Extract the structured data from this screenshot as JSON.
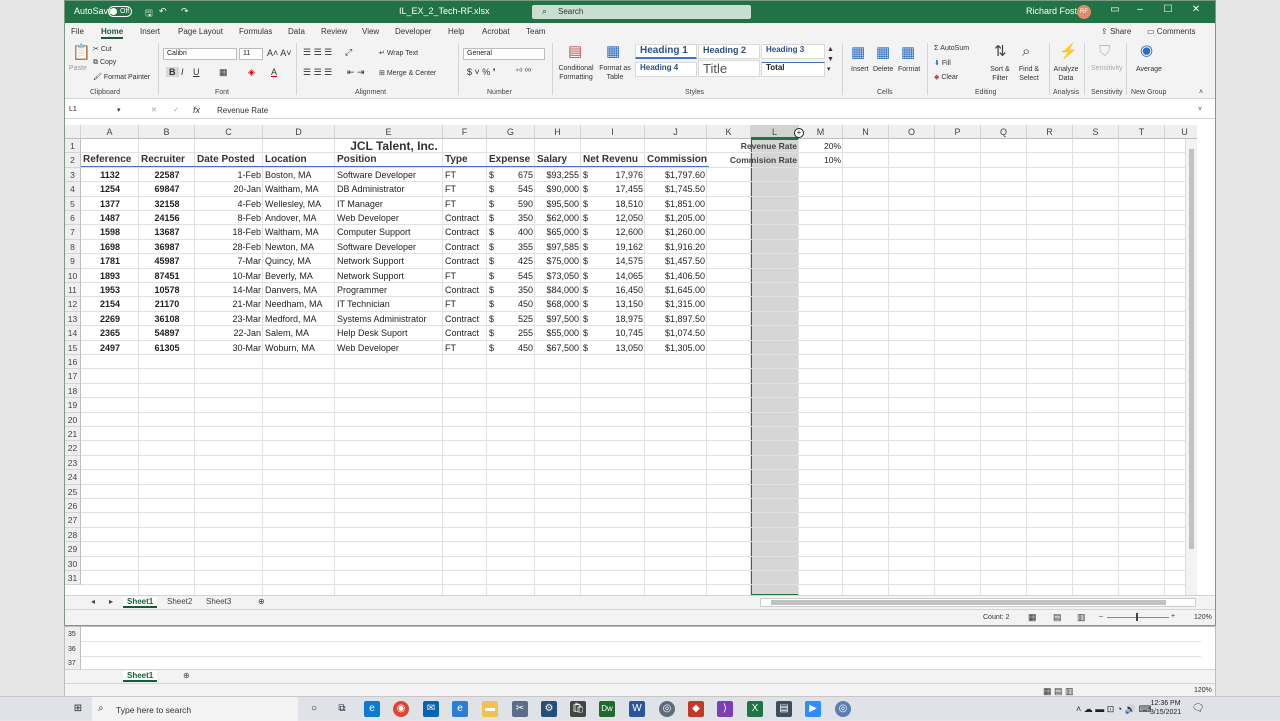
{
  "titlebar": {
    "autosave": "AutoSave",
    "toggle": "Off",
    "filename": "IL_EX_2_Tech-RF.xlsx",
    "search": "Search",
    "user": "Richard Foster",
    "initials": "RF"
  },
  "tabs": [
    "File",
    "Home",
    "Insert",
    "Page Layout",
    "Formulas",
    "Data",
    "Review",
    "View",
    "Developer",
    "Help",
    "Acrobat",
    "Team"
  ],
  "share": "Share",
  "comments": "Comments",
  "ribbon": {
    "paste": "Paste",
    "cut": "Cut",
    "copy": "Copy",
    "format_painter": "Format Painter",
    "clipboard": "Clipboard",
    "font_name": "Calibri",
    "font_size": "11",
    "font": "Font",
    "wrap_text": "Wrap Text",
    "merge_center": "Merge & Center",
    "alignment": "Alignment",
    "number_format": "General",
    "number": "Number",
    "cond_fmt": "Conditional Formatting",
    "format_table": "Format as Table",
    "heading1": "Heading 1",
    "heading2": "Heading 2",
    "heading3": "Heading 3",
    "heading4": "Heading 4",
    "title": "Title",
    "total": "Total",
    "styles": "Styles",
    "insert": "Insert",
    "delete": "Delete",
    "format": "Format",
    "cells": "Cells",
    "autosum": "AutoSum",
    "fill": "Fill",
    "clear": "Clear",
    "sort_filter": "Sort & Filter",
    "find_select": "Find & Select",
    "editing": "Editing",
    "analyze": "Analyze Data",
    "analysis": "Analysis",
    "sensitivity": "Sensitivity",
    "average": "Average",
    "new_group": "New Group"
  },
  "formula_bar": {
    "name_box": "L1",
    "formula": "Revenue Rate"
  },
  "columns": [
    "A",
    "B",
    "C",
    "D",
    "E",
    "F",
    "G",
    "H",
    "I",
    "J",
    "K",
    "L",
    "M",
    "N",
    "O",
    "P",
    "Q",
    "R",
    "S",
    "T",
    "U"
  ],
  "sheet": {
    "title": "JCL Talent, Inc.",
    "headers": [
      "Reference",
      "Recruiter",
      "Date Posted",
      "Location",
      "Position",
      "Type",
      "Expense",
      "Salary",
      "Net Revenu",
      "Commission"
    ],
    "rows": [
      [
        "1132",
        "22587",
        "1-Feb",
        "Boston, MA",
        "Software Developer",
        "FT",
        "$",
        "675",
        "$93,255",
        "$",
        "17,976",
        "$1,797.60"
      ],
      [
        "1254",
        "69847",
        "20-Jan",
        "Waltham, MA",
        "DB Administrator",
        "FT",
        "$",
        "545",
        "$90,000",
        "$",
        "17,455",
        "$1,745.50"
      ],
      [
        "1377",
        "32158",
        "4-Feb",
        "Wellesley, MA",
        "IT Manager",
        "FT",
        "$",
        "590",
        "$95,500",
        "$",
        "18,510",
        "$1,851.00"
      ],
      [
        "1487",
        "24156",
        "8-Feb",
        "Andover, MA",
        "Web Developer",
        "Contract",
        "$",
        "350",
        "$62,000",
        "$",
        "12,050",
        "$1,205.00"
      ],
      [
        "1598",
        "13687",
        "18-Feb",
        "Waltham, MA",
        "Computer Support",
        "Contract",
        "$",
        "400",
        "$65,000",
        "$",
        "12,600",
        "$1,260.00"
      ],
      [
        "1698",
        "36987",
        "28-Feb",
        "Newton, MA",
        "Software Developer",
        "Contract",
        "$",
        "355",
        "$97,585",
        "$",
        "19,162",
        "$1,916.20"
      ],
      [
        "1781",
        "45987",
        "7-Mar",
        "Quincy, MA",
        "Network Support",
        "Contract",
        "$",
        "425",
        "$75,000",
        "$",
        "14,575",
        "$1,457.50"
      ],
      [
        "1893",
        "87451",
        "10-Mar",
        "Beverly, MA",
        "Network Support",
        "FT",
        "$",
        "545",
        "$73,050",
        "$",
        "14,065",
        "$1,406.50"
      ],
      [
        "1953",
        "10578",
        "14-Mar",
        "Danvers, MA",
        "Programmer",
        "Contract",
        "$",
        "350",
        "$84,000",
        "$",
        "16,450",
        "$1,645.00"
      ],
      [
        "2154",
        "21170",
        "21-Mar",
        "Needham, MA",
        "IT Technician",
        "FT",
        "$",
        "450",
        "$68,000",
        "$",
        "13,150",
        "$1,315.00"
      ],
      [
        "2269",
        "36108",
        "23-Mar",
        "Medford, MA",
        "Systems Administrator",
        "Contract",
        "$",
        "525",
        "$97,500",
        "$",
        "18,975",
        "$1,897.50"
      ],
      [
        "2365",
        "54897",
        "22-Jan",
        "Salem, MA",
        "Help Desk Suport",
        "Contract",
        "$",
        "255",
        "$55,000",
        "$",
        "10,745",
        "$1,074.50"
      ],
      [
        "2497",
        "61305",
        "30-Mar",
        "Woburn, MA",
        "Web Developer",
        "FT",
        "$",
        "450",
        "$67,500",
        "$",
        "13,050",
        "$1,305.00"
      ]
    ],
    "side": [
      {
        "label": "Revenue Rate",
        "value": "20%"
      },
      {
        "label": "Commision Rate",
        "value": "10%"
      }
    ]
  },
  "sheet_tabs": [
    "Sheet1",
    "Sheet2",
    "Sheet3"
  ],
  "status": {
    "count": "Count: 2",
    "zoom": "120%"
  },
  "lower": {
    "rows": [
      "35",
      "36",
      "37"
    ],
    "tab": "Sheet1"
  },
  "taskbar": {
    "search": "Type here to search",
    "time": "12:36 PM",
    "date": "3/15/2021"
  }
}
